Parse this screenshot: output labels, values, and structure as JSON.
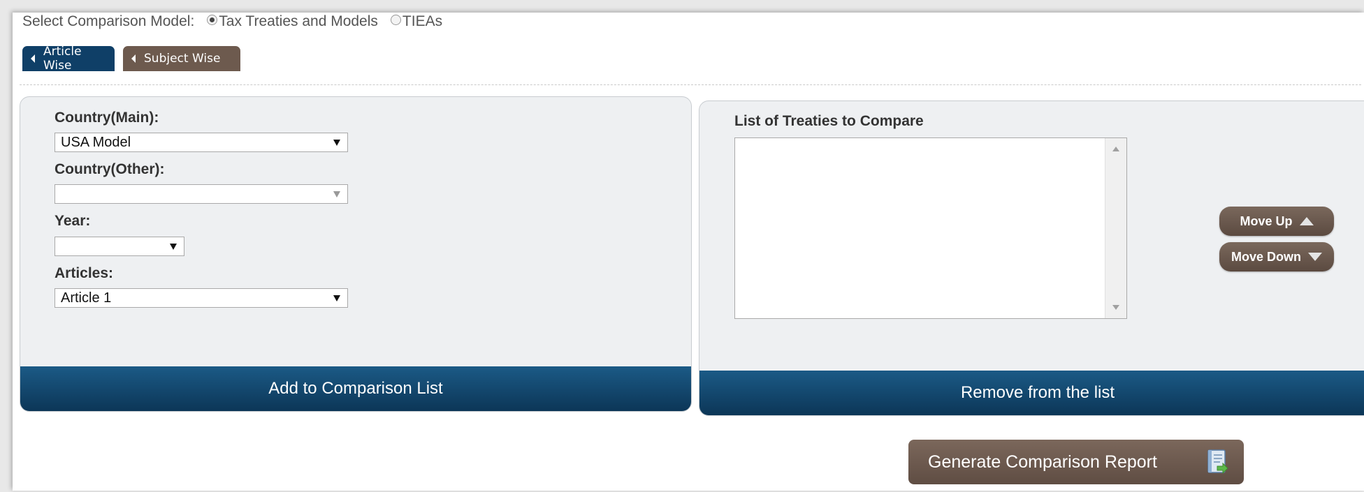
{
  "model_select": {
    "label": "Select Comparison Model:",
    "options": [
      {
        "label": "Tax Treaties and Models",
        "checked": true
      },
      {
        "label": "TIEAs",
        "checked": false
      }
    ]
  },
  "tabs": [
    {
      "label": "Article Wise",
      "color": "#0f3f67",
      "active": true
    },
    {
      "label": "Subject Wise",
      "color": "#6d5a4e",
      "active": false
    }
  ],
  "left_panel": {
    "country_main_label": "Country(Main):",
    "country_main_value": "USA Model",
    "country_other_label": "Country(Other):",
    "country_other_value": "",
    "year_label": "Year:",
    "year_value": "",
    "articles_label": "Articles:",
    "articles_value": "Article 1",
    "add_button": "Add to Comparison List"
  },
  "right_panel": {
    "list_label": "List of Treaties to Compare",
    "list_items": [],
    "move_up": "Move Up",
    "move_down": "Move Down",
    "remove_button": "Remove from the list"
  },
  "generate_button": "Generate Comparison Report",
  "colors": {
    "primary_blue": "#0c3657",
    "brown": "#6d5a4e",
    "panel_bg": "#eef0f2"
  },
  "icons": [
    "triangle-left-icon",
    "triangle-up-icon",
    "triangle-down-icon",
    "report-icon"
  ]
}
